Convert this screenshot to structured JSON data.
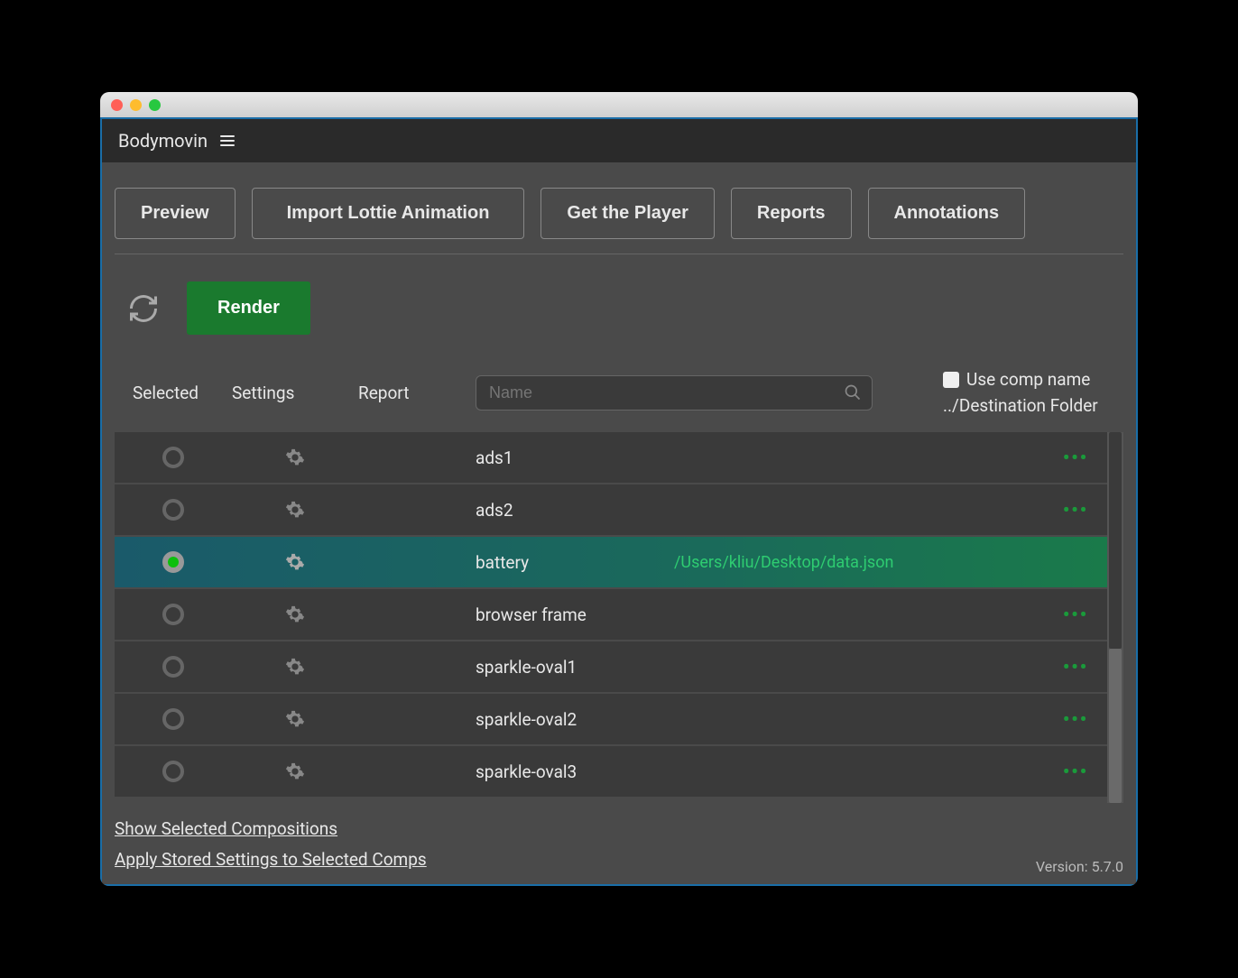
{
  "header": {
    "title": "Bodymovin"
  },
  "nav": {
    "preview": "Preview",
    "import": "Import Lottie Animation",
    "getPlayer": "Get the Player",
    "reports": "Reports",
    "annotations": "Annotations"
  },
  "actions": {
    "render": "Render"
  },
  "columns": {
    "selected": "Selected",
    "settings": "Settings",
    "report": "Report",
    "searchPlaceholder": "Name",
    "useCompName": "Use comp name",
    "destFolder": "../Destination Folder"
  },
  "compositions": [
    {
      "name": "ads1",
      "selected": false,
      "path": ""
    },
    {
      "name": "ads2",
      "selected": false,
      "path": ""
    },
    {
      "name": "battery",
      "selected": true,
      "path": "/Users/kliu/Desktop/data.json"
    },
    {
      "name": "browser frame",
      "selected": false,
      "path": ""
    },
    {
      "name": "sparkle-oval1",
      "selected": false,
      "path": ""
    },
    {
      "name": "sparkle-oval2",
      "selected": false,
      "path": ""
    },
    {
      "name": "sparkle-oval3",
      "selected": false,
      "path": ""
    }
  ],
  "footer": {
    "showSelected": "Show Selected Compositions",
    "applySettings": "Apply Stored Settings to Selected Comps",
    "version": "Version: 5.7.0"
  }
}
